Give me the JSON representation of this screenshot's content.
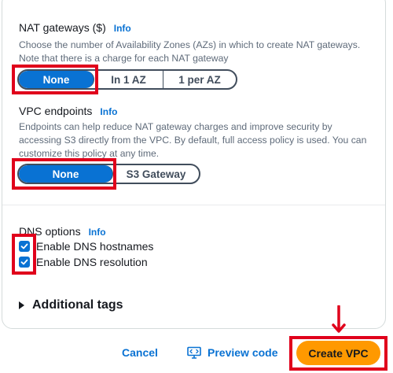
{
  "nat": {
    "title": "NAT gateways ($)",
    "info": "Info",
    "description": "Choose the number of Availability Zones (AZs) in which to create NAT gateways. Note that there is a charge for each NAT gateway",
    "options": [
      "None",
      "In 1 AZ",
      "1 per AZ"
    ],
    "selected": "None"
  },
  "endpoints": {
    "title": "VPC endpoints",
    "info": "Info",
    "description": "Endpoints can help reduce NAT gateway charges and improve security by accessing S3 directly from the VPC. By default, full access policy is used. You can customize this policy at any time.",
    "options": [
      "None",
      "S3 Gateway"
    ],
    "selected": "None"
  },
  "dns": {
    "title": "DNS options",
    "info": "Info",
    "hostnames_label": "Enable DNS hostnames",
    "hostnames_checked": true,
    "resolution_label": "Enable DNS resolution",
    "resolution_checked": true
  },
  "additional_tags": {
    "label": "Additional tags"
  },
  "footer": {
    "cancel": "Cancel",
    "preview": "Preview code",
    "create": "Create VPC"
  },
  "colors": {
    "primary": "#0972d3",
    "create_button": "#ff9900",
    "highlight": "#e0001b"
  },
  "icons": {
    "preview": "code-preview-icon",
    "checkbox": "checkmark-icon",
    "expand": "caret-right-icon",
    "arrow": "arrow-down-icon"
  }
}
